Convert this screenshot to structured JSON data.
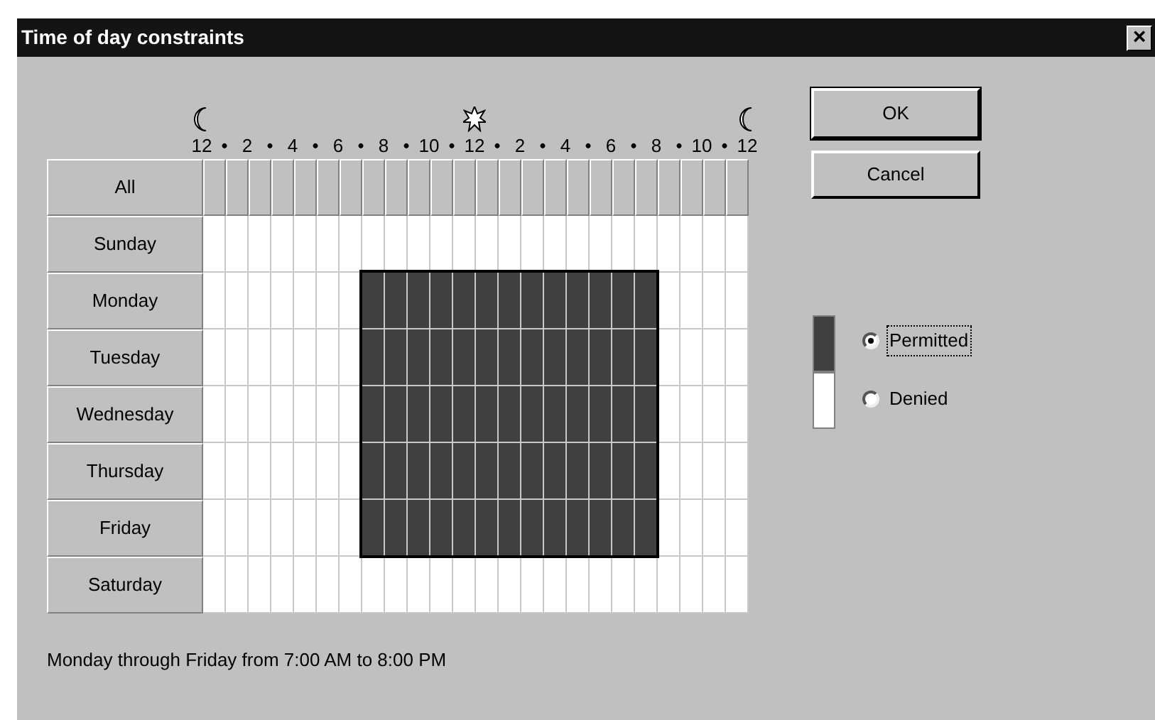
{
  "window": {
    "title": "Time of day constraints",
    "close": "×"
  },
  "ruler": {
    "labels": [
      "12",
      "•",
      "2",
      "•",
      "4",
      "•",
      "6",
      "•",
      "8",
      "•",
      "10",
      "•",
      "12",
      "•",
      "2",
      "•",
      "4",
      "•",
      "6",
      "•",
      "8",
      "•",
      "10",
      "•",
      "12"
    ],
    "icons": [
      {
        "kind": "moon"
      },
      {
        "kind": "sun"
      },
      {
        "kind": "moon"
      }
    ]
  },
  "all_button": "All",
  "days": [
    {
      "label": "Sunday",
      "hours": [
        false,
        false,
        false,
        false,
        false,
        false,
        false,
        false,
        false,
        false,
        false,
        false,
        false,
        false,
        false,
        false,
        false,
        false,
        false,
        false,
        false,
        false,
        false,
        false
      ]
    },
    {
      "label": "Monday",
      "hours": [
        false,
        false,
        false,
        false,
        false,
        false,
        false,
        true,
        true,
        true,
        true,
        true,
        true,
        true,
        true,
        true,
        true,
        true,
        true,
        true,
        false,
        false,
        false,
        false
      ]
    },
    {
      "label": "Tuesday",
      "hours": [
        false,
        false,
        false,
        false,
        false,
        false,
        false,
        true,
        true,
        true,
        true,
        true,
        true,
        true,
        true,
        true,
        true,
        true,
        true,
        true,
        false,
        false,
        false,
        false
      ]
    },
    {
      "label": "Wednesday",
      "hours": [
        false,
        false,
        false,
        false,
        false,
        false,
        false,
        true,
        true,
        true,
        true,
        true,
        true,
        true,
        true,
        true,
        true,
        true,
        true,
        true,
        false,
        false,
        false,
        false
      ]
    },
    {
      "label": "Thursday",
      "hours": [
        false,
        false,
        false,
        false,
        false,
        false,
        false,
        true,
        true,
        true,
        true,
        true,
        true,
        true,
        true,
        true,
        true,
        true,
        true,
        true,
        false,
        false,
        false,
        false
      ]
    },
    {
      "label": "Friday",
      "hours": [
        false,
        false,
        false,
        false,
        false,
        false,
        false,
        true,
        true,
        true,
        true,
        true,
        true,
        true,
        true,
        true,
        true,
        true,
        true,
        true,
        false,
        false,
        false,
        false
      ]
    },
    {
      "label": "Saturday",
      "hours": [
        false,
        false,
        false,
        false,
        false,
        false,
        false,
        false,
        false,
        false,
        false,
        false,
        false,
        false,
        false,
        false,
        false,
        false,
        false,
        false,
        false,
        false,
        false,
        false
      ]
    }
  ],
  "buttons": [
    {
      "label": "OK",
      "default": true
    },
    {
      "label": "Cancel",
      "default": false
    }
  ],
  "options": [
    {
      "label": "Permitted",
      "selected": true,
      "focused": true,
      "kind": "permitted"
    },
    {
      "label": "Denied",
      "selected": false,
      "focused": false,
      "kind": "denied"
    }
  ],
  "summary": "Monday through Friday from 7:00 AM to 8:00 PM"
}
